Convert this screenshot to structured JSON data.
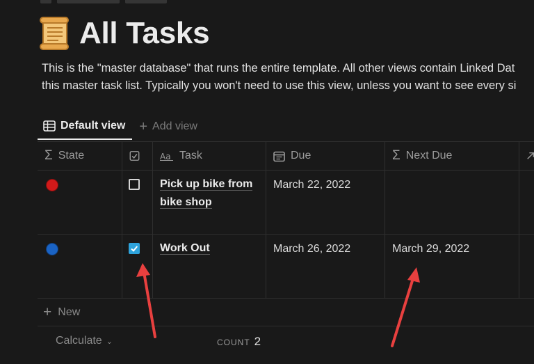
{
  "page": {
    "title": "All Tasks",
    "icon": "scroll-icon",
    "description_line1": "This is the \"master database\" that runs the entire template. All other views contain Linked Dat",
    "description_line2": "this master task list. Typically you won't need to use this view, unless you want to see every si"
  },
  "views": {
    "default_label": "Default view",
    "add_label": "Add view"
  },
  "table": {
    "columns": {
      "state": "State",
      "task": "Task",
      "due": "Due",
      "next_due": "Next Due"
    },
    "rows": [
      {
        "state_color": "#d11a1a",
        "done": false,
        "task": "Pick up bike from bike shop",
        "due": "March 22, 2022",
        "next_due": ""
      },
      {
        "state_color": "#1a63c4",
        "done": true,
        "task": "Work Out",
        "due": "March 26, 2022",
        "next_due": "March 29, 2022"
      }
    ],
    "new_label": "New",
    "calculate_label": "Calculate",
    "count_label": "COUNT",
    "count_value": "2"
  },
  "colors": {
    "background": "#191919",
    "checkbox_checked": "#2ea3dc",
    "annotation_arrow": "#e8403f"
  }
}
